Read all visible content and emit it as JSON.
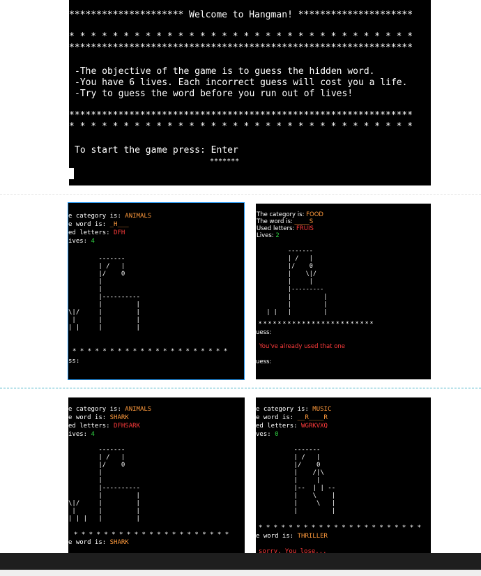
{
  "main_terminal": {
    "line1": "********************* Welcome to Hangman! *********************",
    "line2": "* * * * * * * * * * * * * * * * * * * * * * * * * * * * * * * *",
    "line3": "***************************************************************",
    "objective": "-The objective of the game is to guess the hidden word.",
    "lives_info": "-You have 6 lives. Each incorrect guess will cost you a life.",
    "try_info": "-Try to guess the word before you run out of lives!",
    "line4": "***************************************************************",
    "line5": "* * * * * * * * * * * * * * * * * * * * * * * * * * * * * * * *",
    "start_prompt": "To start the game press: Enter",
    "stars": "*******"
  },
  "shot1": {
    "category_label": "e category is: ",
    "category_value": "ANIMALS",
    "word_label": "e word is: ",
    "word_value": "_H___",
    "used_label": "ed letters: ",
    "used_value": "DFH",
    "lives_label": "ives: ",
    "lives_value": "4",
    "gallows": "        -------\n        | /   |\n        |/    0\n        |\n        |\n        |----------\n        |         |\n\\|/     |         |\n |      |         |\n| |     |         |",
    "stars": "* * * * * * * * * * * * * * * * * * * * *",
    "prompt": "ss:"
  },
  "shot2": {
    "category_label": "The category is: ",
    "category_value": "FOOD",
    "word_label": "The word is: ",
    "word_value": "_____S",
    "used_label": "Used letters: ",
    "used_value": "FRUIS",
    "lives_label": "Lives: ",
    "lives_value": "2",
    "gallows": "         -------\n         | /   |\n         |/    0\n         |    \\|/\n         |     |\n         |---------\n         |         |\n         |         |\n   | |   |         |",
    "stars": "* * * * * * * * * * * * * * * * * * * * * * * *",
    "guess_label": "uess:",
    "message": " You've already used that one",
    "guess_label2": "uess:"
  },
  "shot3": {
    "category_label": "e category is: ",
    "category_value": "ANIMALS",
    "word_label": "e word is: ",
    "word_value": "SHARK",
    "used_label": "ed letters: ",
    "used_value": "DFHSARK",
    "lives_label": "ives: ",
    "lives_value": "4",
    "gallows": "        -------\n        | /   |\n        |/    0\n        |\n        |\n        |----------\n        |         |\n\\|/     |         |\n |      |         |\n| | |   |         |",
    "stars": "* * * * * * * * * * * * * * * * * * * * *",
    "word_label2": "e word is: ",
    "word_value2": "SHARK"
  },
  "shot4": {
    "category_label": "e category is: ",
    "category_value": "MUSIC",
    "word_label": "e word is: ",
    "word_value": "__R____R",
    "used_label": "ed letters: ",
    "used_value": "WGRKVXQ",
    "lives_label": "ves: ",
    "lives_value": "0",
    "gallows": "      -------\n      | /   |\n      |/    0\n      |    /|\\\n      |     |\n      |--  | | --\n      |    \\    |\n      |     \\   |\n      |         |",
    "stars": "* * * * * * * * * * * * * * * * * * * * * *",
    "word_label2": "e word is: ",
    "word_value2": "THRILLER",
    "message": "sorry. You lose..."
  },
  "colors": {
    "terminal_bg": "#000000",
    "accent": "#ff9a3c",
    "error": "#ff3b3b",
    "lives": "#2ecc40"
  }
}
